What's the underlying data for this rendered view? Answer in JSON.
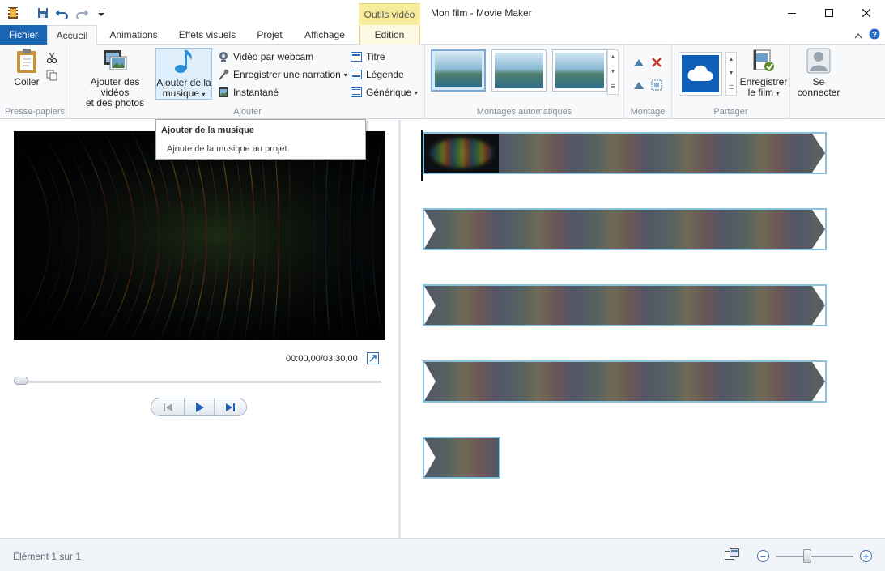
{
  "window": {
    "title": "Mon film - Movie Maker",
    "context_tab_label": "Outils vidéo"
  },
  "tabs": [
    {
      "label": "Fichier"
    },
    {
      "label": "Accueil"
    },
    {
      "label": "Animations"
    },
    {
      "label": "Effets visuels"
    },
    {
      "label": "Projet"
    },
    {
      "label": "Affichage"
    },
    {
      "label": "Edition"
    }
  ],
  "ribbon": {
    "clipboard": {
      "paste_label": "Coller",
      "group_label": "Presse-papiers"
    },
    "add": {
      "add_videos_line1": "Ajouter des vidéos",
      "add_videos_line2": "et des photos",
      "add_music_line1": "Ajouter de la",
      "add_music_line2": "musique",
      "webcam_label": "Vidéo par webcam",
      "narration_label": "Enregistrer une narration",
      "snapshot_label": "Instantané",
      "title_label": "Titre",
      "caption_label": "Légende",
      "credits_label": "Générique",
      "group_label": "Ajouter"
    },
    "automovie": {
      "group_label": "Montages automatiques"
    },
    "editing": {
      "group_label": "Montage"
    },
    "share": {
      "save_movie_line1": "Enregistrer",
      "save_movie_line2": "le film",
      "group_label": "Partager"
    },
    "signin": {
      "line1": "Se",
      "line2": "connecter"
    }
  },
  "tooltip": {
    "title": "Ajouter de la musique",
    "body": "Ajoute de la musique au projet."
  },
  "preview": {
    "time": "00:00,00/03:30,00"
  },
  "status": {
    "text": "Élément 1 sur 1"
  },
  "colors": {
    "accent": "#1a66b5",
    "context_tab": "#f7ec9c",
    "clip_border": "#89c2de"
  },
  "zoom": {
    "level_fraction": 0.4
  }
}
